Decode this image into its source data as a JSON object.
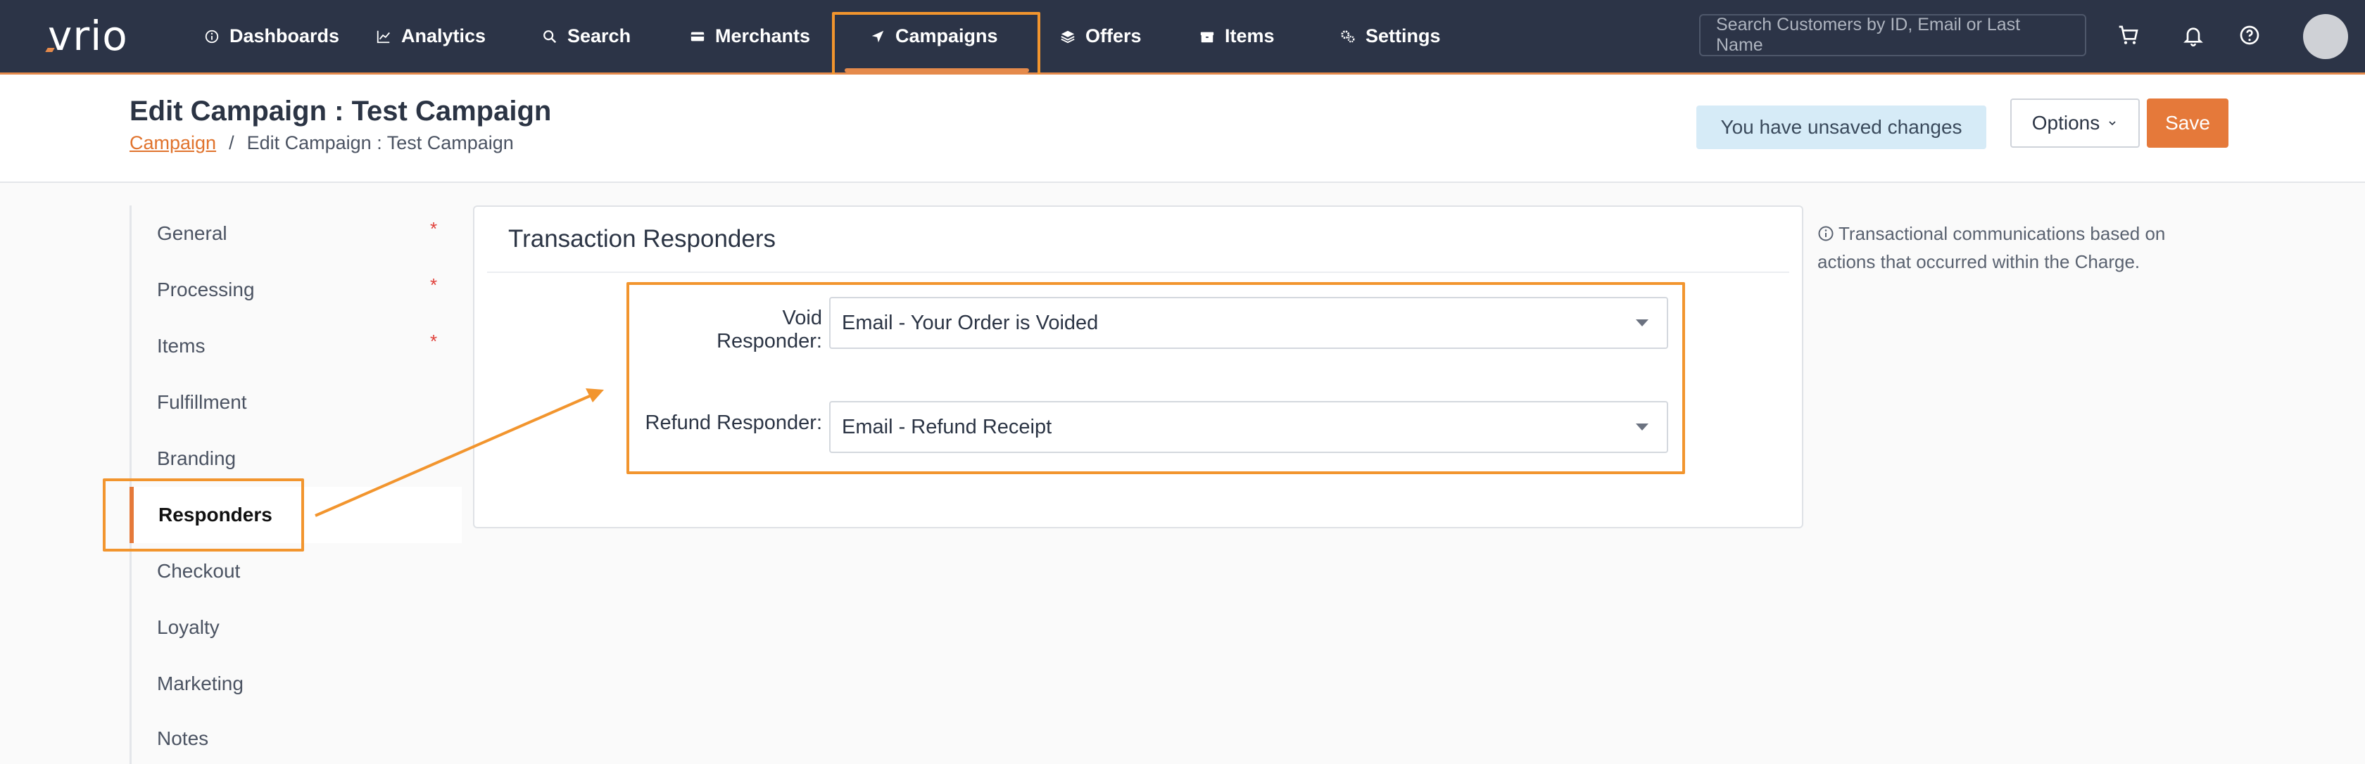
{
  "app": {
    "logo": "vrio"
  },
  "nav": {
    "items": [
      {
        "label": "Dashboards",
        "icon": "info-circle-icon"
      },
      {
        "label": "Analytics",
        "icon": "line-chart-icon"
      },
      {
        "label": "Search",
        "icon": "search-icon"
      },
      {
        "label": "Merchants",
        "icon": "credit-card-icon"
      },
      {
        "label": "Campaigns",
        "icon": "paper-plane-icon",
        "active": true
      },
      {
        "label": "Offers",
        "icon": "layers-icon"
      },
      {
        "label": "Items",
        "icon": "box-icon"
      },
      {
        "label": "Settings",
        "icon": "gears-icon"
      }
    ],
    "search_placeholder": "Search Customers by ID, Email or Last Name"
  },
  "header": {
    "title": "Edit Campaign : Test Campaign",
    "breadcrumb": {
      "link": "Campaign",
      "separator": "/",
      "current": "Edit Campaign : Test Campaign"
    },
    "unsaved_notice": "You have unsaved changes",
    "options_label": "Options",
    "save_label": "Save"
  },
  "sidebar": {
    "items": [
      {
        "label": "General",
        "required": true
      },
      {
        "label": "Processing",
        "required": true
      },
      {
        "label": "Items",
        "required": true
      },
      {
        "label": "Fulfillment",
        "required": false
      },
      {
        "label": "Branding",
        "required": false
      },
      {
        "label": "Responders",
        "required": false,
        "active": true
      },
      {
        "label": "Checkout",
        "required": false
      },
      {
        "label": "Loyalty",
        "required": false
      },
      {
        "label": "Marketing",
        "required": false
      },
      {
        "label": "Notes",
        "required": false
      }
    ],
    "required_marker": "*"
  },
  "panel": {
    "title": "Transaction Responders",
    "fields": [
      {
        "label": "Void Responder:",
        "value": "Email - Your Order is Voided"
      },
      {
        "label": "Refund Responder:",
        "value": "Email - Refund Receipt"
      }
    ]
  },
  "help": {
    "text": "Transactional communications based on actions that occurred within the Charge."
  },
  "colors": {
    "topbar": "#2c3447",
    "accent": "#e5793a",
    "annotation": "#f2952e",
    "unsaved_bg": "#d6ebf7"
  }
}
